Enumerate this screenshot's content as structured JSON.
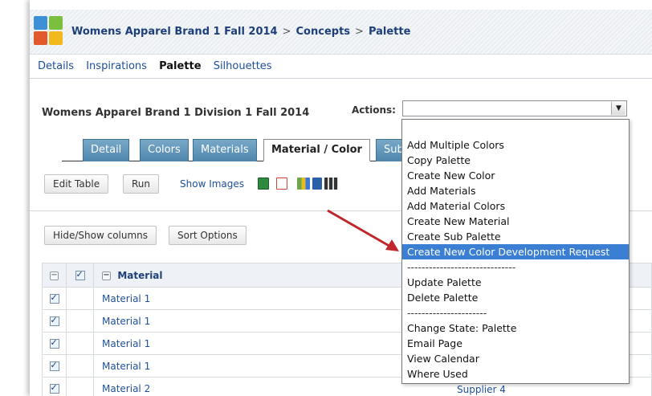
{
  "breadcrumb": {
    "brand": "Womens Apparel Brand 1 Fall 2014",
    "sep": ">",
    "concepts": "Concepts",
    "palette": "Palette"
  },
  "subnav": [
    "Details",
    "Inspirations",
    "Palette",
    "Silhouettes"
  ],
  "division_title": "Womens Apparel Brand 1 Division 1 Fall 2014",
  "actions": {
    "label": "Actions:",
    "selected_value": "",
    "options": [
      "Add Multiple Colors",
      "Copy Palette",
      "Create New Color",
      "Add Materials",
      "Add Material Colors",
      "Create New Material",
      "Create Sub Palette",
      "Create New Color Development Request",
      "------------------------------",
      "Update Palette",
      "Delete Palette",
      "----------------------",
      "Change State: Palette",
      "Email Page",
      "View Calendar",
      "Where Used"
    ],
    "highlighted": "Create New Color Development Request"
  },
  "tabs": [
    "Detail",
    "Colors",
    "Materials",
    "Material / Color",
    "Sub"
  ],
  "toolbar": {
    "edit_table": "Edit Table",
    "run": "Run",
    "show_images": "Show Images",
    "hide_show_columns": "Hide/Show columns",
    "sort_options": "Sort Options"
  },
  "table": {
    "column_header": "Material",
    "rows": [
      "Material 1",
      "Material 1",
      "Material 1",
      "Material 1",
      "Material 2"
    ]
  },
  "supplier_text": "Supplier 4",
  "colors": {
    "tab_blue": "#4f86ad",
    "link": "#1d4f9a",
    "highlight": "#3b7fd4",
    "arrow": "#c0272d"
  }
}
